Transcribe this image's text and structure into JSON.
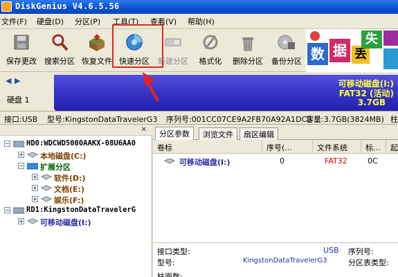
{
  "window": {
    "title": "DiskGenius V4.6.5.56"
  },
  "menu": [
    "文件(F)",
    "硬盘(D)",
    "分区(P)",
    "工具(T)",
    "查看(V)",
    "帮助(H)"
  ],
  "toolbar": {
    "save": "保存更改",
    "search": "搜索分区",
    "recover": "恢复文件",
    "quick": "快速分区",
    "new": "新建分区",
    "format": "格式化",
    "delete": "删除分区",
    "backup": "备份分区"
  },
  "ad": {
    "c1": "数",
    "c2": "据",
    "c3": "丢",
    "c4": "失"
  },
  "diskbar": {
    "nav_left": "◀",
    "nav_right": "▶",
    "disk_label": "硬盘 1",
    "part_name": "可移动磁盘(I:)",
    "part_fs": "FAT32 (活动)",
    "part_size": "3.7GB"
  },
  "info": {
    "iface": "接口:USB",
    "model": "型号:KingstonDataTravelerG3",
    "serial": "序列号:001CC07CE9A2FB70A92A1DC3",
    "capacity": "容量:3.7GB(3824MB)",
    "more": "柱"
  },
  "tree": {
    "hd0": "HD0:WDCWD5000AAKX-08U6AA0",
    "local_c": "本地磁盘(C:)",
    "extended": "扩展分区",
    "soft": "软件(D:)",
    "docs": "文档(E:)",
    "fun": "娱乐(F:)",
    "rd1": "RD1:KingstonDataTravelerG",
    "usb": "可移动磁盘(I:)"
  },
  "tabs": [
    "分区参数",
    "浏览文件",
    "扇区编辑"
  ],
  "columns": [
    "卷标",
    "序号(...",
    "文件系统",
    "标...",
    "起"
  ],
  "rows": [
    {
      "label": "可移动磁盘(I:)",
      "index": "0",
      "fs": "FAT32",
      "flag": "0C"
    }
  ],
  "props": {
    "iface_label": "接口类型:",
    "model_label": "型号:",
    "model_value": "KingstonDataTravelerG3",
    "serial_label": "序列号:",
    "part_table_label": "分区表类型:",
    "usb_frag": "USB",
    "cyl_label": "柱面数:"
  },
  "colors": {
    "accent": "#2420b0",
    "highlight": "#e52323",
    "title_blue": "#0a4fd0"
  }
}
